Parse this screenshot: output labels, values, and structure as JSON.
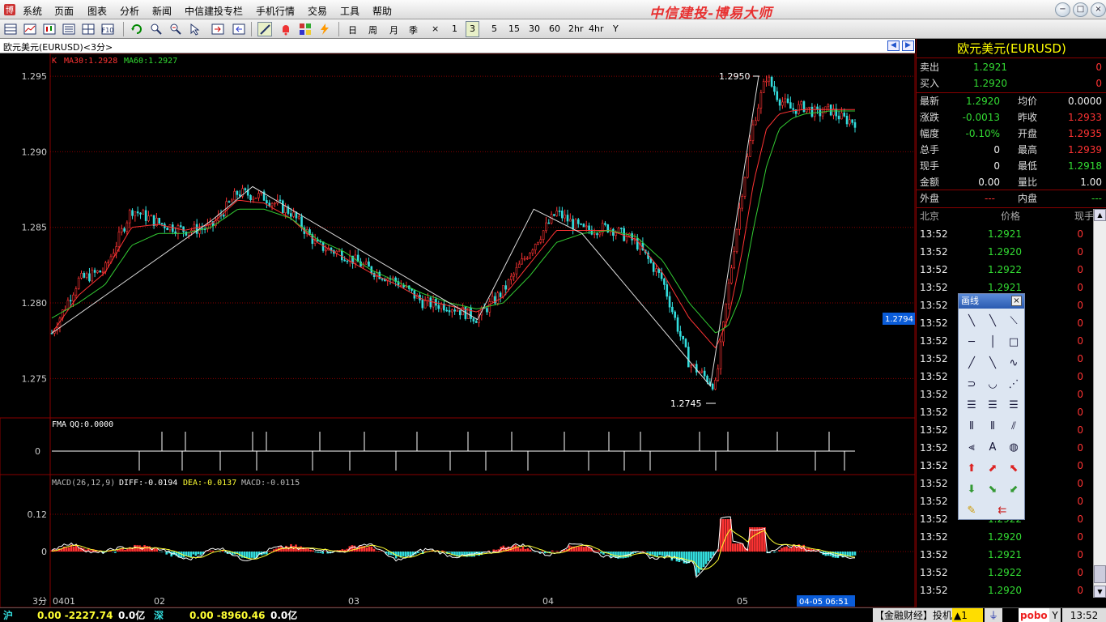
{
  "menubar": {
    "items": [
      "系统",
      "页面",
      "图表",
      "分析",
      "新闻",
      "中信建投专栏",
      "手机行情",
      "交易",
      "工具",
      "帮助"
    ],
    "app_title": "中信建投-博易大师"
  },
  "toolbar": {
    "periods": [
      "日",
      "周",
      "月",
      "季",
      "×",
      "1",
      "3",
      "5",
      "15",
      "30",
      "60",
      "2hr",
      "4hr",
      "Y"
    ],
    "active_period": "3"
  },
  "chart": {
    "title": "欧元美元(EURUSD)<3分>",
    "main_legend": {
      "k": "K",
      "ma30": "MA30:1.2928",
      "ma60": "MA60:1.2927"
    },
    "y_ticks": [
      "1.295",
      "1.290",
      "1.285",
      "1.280",
      "1.275"
    ],
    "high_label": "1.2950",
    "low_label": "1.2745",
    "price_marker": "1.2794",
    "fma_legend": {
      "name": "FMA",
      "qq": "QQ:0.0000"
    },
    "fma_zero": "0",
    "macd_legend": {
      "name": "MACD(26,12,9)",
      "diff": "DIFF:-0.0194",
      "dea": "DEA:-0.0137",
      "macd": "MACD:-0.0115"
    },
    "macd_ticks": [
      "0.12",
      "0"
    ],
    "x_labels": [
      "0401",
      "02",
      "03",
      "04",
      "05"
    ],
    "period_label": "3分",
    "cursor_time": "04-05 06:51"
  },
  "chart_data": {
    "type": "line",
    "title": "欧元美元(EURUSD)<3分>",
    "xlabel": "",
    "ylabel": "",
    "ylim": [
      1.2725,
      1.2964
    ],
    "x_categories": [
      "0401",
      "02",
      "03",
      "04",
      "05"
    ],
    "series": [
      {
        "name": "K",
        "note": "candlestick close path (approx)",
        "x": [
          0,
          8,
          16,
          24,
          32,
          40,
          48,
          56,
          64,
          72,
          80,
          88,
          96,
          104,
          112,
          120,
          128,
          136,
          144,
          152,
          160,
          168,
          176,
          184,
          192,
          200
        ],
        "values": [
          1.278,
          1.2815,
          1.2822,
          1.2862,
          1.2853,
          1.2848,
          1.285,
          1.2873,
          1.287,
          1.286,
          1.2838,
          1.2832,
          1.2822,
          1.2814,
          1.28,
          1.2798,
          1.279,
          1.2808,
          1.2835,
          1.286,
          1.2848,
          1.285,
          1.284,
          1.2815,
          1.276,
          1.2745
        ]
      },
      {
        "name": "MA30",
        "values": [
          1.278,
          1.2805,
          1.282,
          1.285,
          1.2852,
          1.2848,
          1.2852,
          1.2868,
          1.2866,
          1.2856,
          1.284,
          1.283,
          1.282,
          1.2812,
          1.2802,
          1.2798,
          1.2794,
          1.2804,
          1.2826,
          1.2848,
          1.2848,
          1.2848,
          1.2842,
          1.282,
          1.279,
          1.277
        ]
      },
      {
        "name": "MA60",
        "values": [
          1.279,
          1.28,
          1.2812,
          1.2838,
          1.2846,
          1.2846,
          1.285,
          1.2862,
          1.2862,
          1.2856,
          1.2842,
          1.2834,
          1.2822,
          1.2814,
          1.2806,
          1.28,
          1.2796,
          1.28,
          1.2818,
          1.284,
          1.2846,
          1.2848,
          1.2844,
          1.2828,
          1.28,
          1.278
        ]
      }
    ],
    "annotations": [
      "1.2950",
      "1.2745"
    ],
    "grid": true
  },
  "quote": {
    "title": "欧元美元(EURUSD)",
    "rows": [
      {
        "l": "卖出",
        "v": "1.2921",
        "v2": "0"
      },
      {
        "l": "买入",
        "v": "1.2920",
        "v2": "0"
      }
    ],
    "stats": [
      {
        "l1": "最新",
        "v1": "1.2920",
        "l2": "均价",
        "v2": "0.0000"
      },
      {
        "l1": "涨跌",
        "v1": "-0.0013",
        "l2": "昨收",
        "v2": "1.2933"
      },
      {
        "l1": "幅度",
        "v1": "-0.10%",
        "l2": "开盘",
        "v2": "1.2935"
      },
      {
        "l1": "总手",
        "v1": "0",
        "l2": "最高",
        "v2": "1.2939"
      },
      {
        "l1": "现手",
        "v1": "0",
        "l2": "最低",
        "v2": "1.2918"
      },
      {
        "l1": "金额",
        "v1": "0.00",
        "l2": "量比",
        "v2": "1.00"
      }
    ],
    "outer": {
      "l1": "外盘",
      "v1": "---",
      "l2": "内盘",
      "v2": "---"
    },
    "tick_header": {
      "time": "北京",
      "price": "价格",
      "vol": "现手"
    },
    "ticks": [
      {
        "t": "13:52",
        "p": "1.2921",
        "v": "0"
      },
      {
        "t": "13:52",
        "p": "1.2920",
        "v": "0"
      },
      {
        "t": "13:52",
        "p": "1.2922",
        "v": "0"
      },
      {
        "t": "13:52",
        "p": "1.2921",
        "v": "0"
      },
      {
        "t": "13:52",
        "p": "",
        "v": "0"
      },
      {
        "t": "13:52",
        "p": "",
        "v": "0"
      },
      {
        "t": "13:52",
        "p": "",
        "v": "0"
      },
      {
        "t": "13:52",
        "p": "",
        "v": "0"
      },
      {
        "t": "13:52",
        "p": "",
        "v": "0"
      },
      {
        "t": "13:52",
        "p": "",
        "v": "0"
      },
      {
        "t": "13:52",
        "p": "",
        "v": "0"
      },
      {
        "t": "13:52",
        "p": "",
        "v": "0"
      },
      {
        "t": "13:52",
        "p": "",
        "v": "0"
      },
      {
        "t": "13:52",
        "p": "",
        "v": "0"
      },
      {
        "t": "13:52",
        "p": "",
        "v": "0"
      },
      {
        "t": "13:52",
        "p": "",
        "v": "0"
      },
      {
        "t": "13:52",
        "p": "1.2922",
        "v": "0"
      },
      {
        "t": "13:52",
        "p": "1.2920",
        "v": "0"
      },
      {
        "t": "13:52",
        "p": "1.2921",
        "v": "0"
      },
      {
        "t": "13:52",
        "p": "1.2922",
        "v": "0"
      },
      {
        "t": "13:52",
        "p": "1.2920",
        "v": "0"
      }
    ]
  },
  "draw_palette": {
    "title": "画线",
    "close": "×"
  },
  "statusbar": {
    "sh_label": "沪",
    "sh_values": "0.00 -2227.74",
    "sh_amount": "0.0亿",
    "sz_label": "深",
    "sz_values": "0.00 -8960.46",
    "sz_amount": "0.0亿",
    "news": "【金融财经】投机情",
    "alert": "▲1",
    "brand": "pobo",
    "clock": "13:52"
  },
  "colors": {
    "up": "#ff3333",
    "down": "#33dddd",
    "ma30": "#ff3333",
    "ma60": "#33cc33",
    "grid": "#880000"
  }
}
